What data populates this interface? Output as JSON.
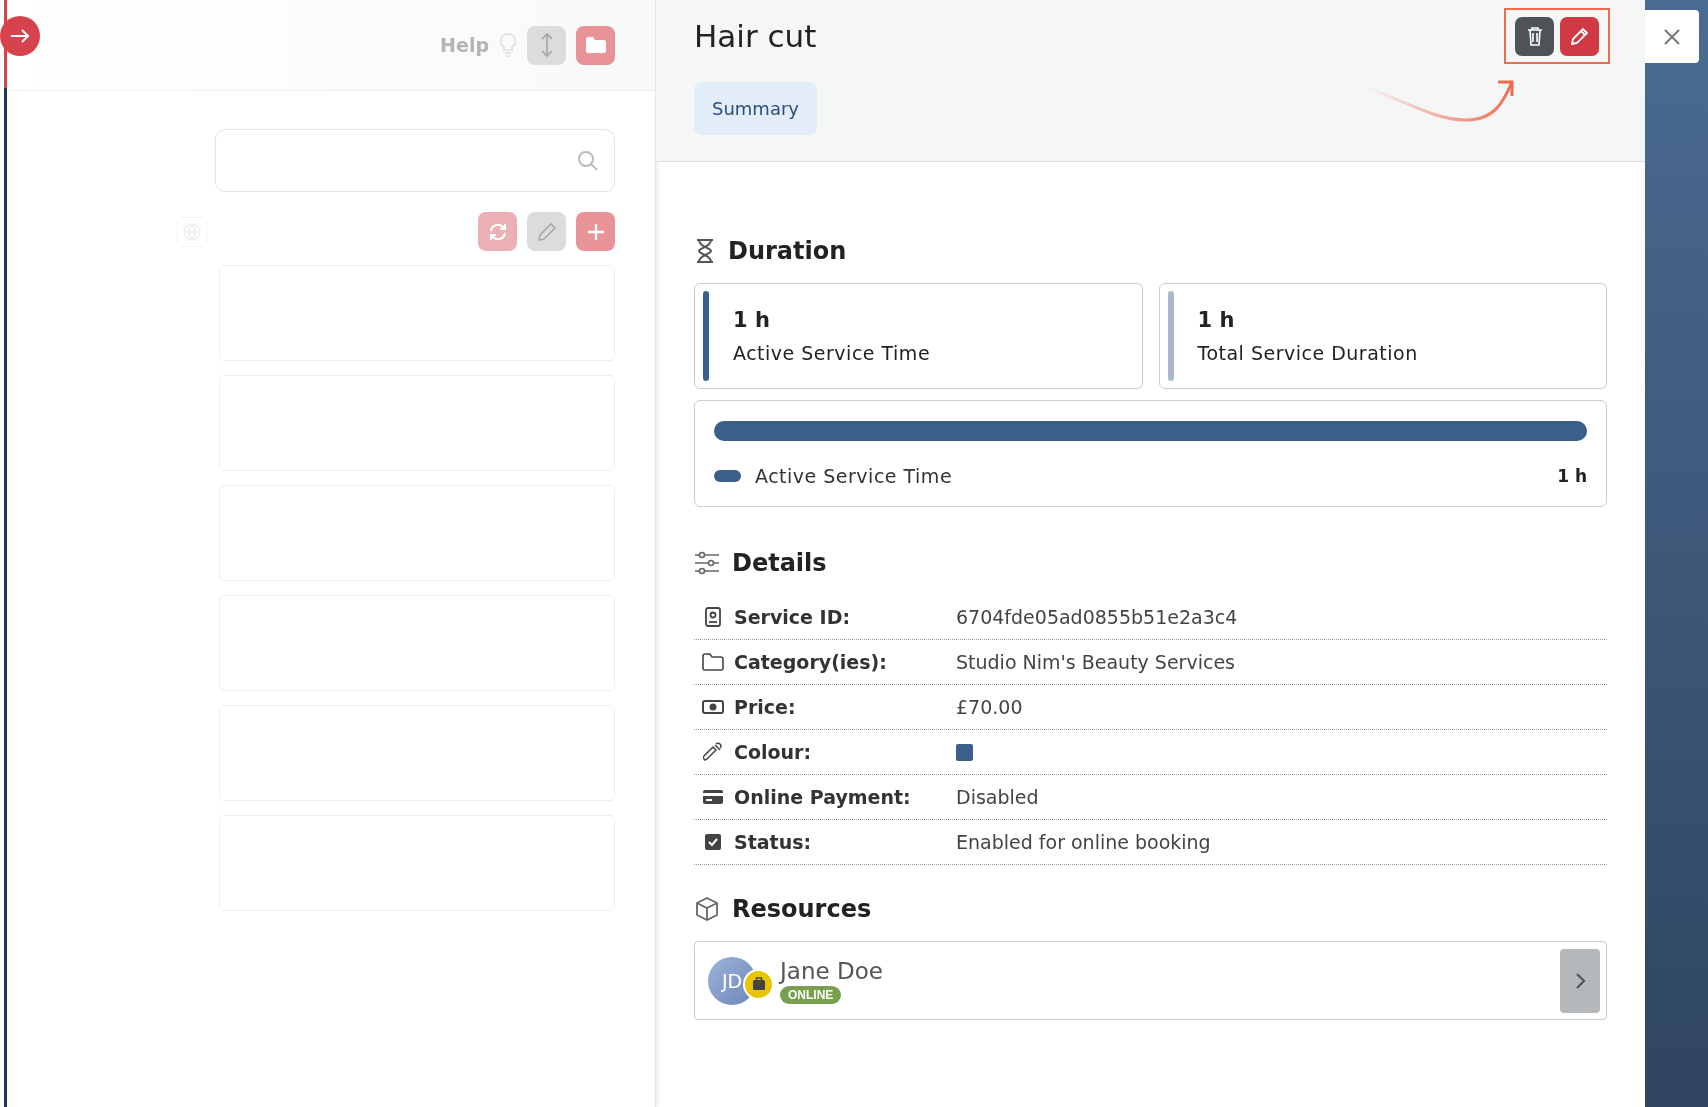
{
  "sidebar": {
    "help_label": "Help"
  },
  "panel": {
    "title": "Hair cut",
    "tabs": [
      {
        "label": "Summary",
        "selected": true
      }
    ],
    "duration": {
      "heading": "Duration",
      "cards": [
        {
          "value": "1 h",
          "label": "Active Service Time",
          "color": "#3a5f8a"
        },
        {
          "value": "1 h",
          "label": "Total Service Duration",
          "color": "#a9b8cb"
        }
      ],
      "bar": {
        "level": 1,
        "color": "#3a5f8a",
        "label": "Active Service Time",
        "reading": "1 h"
      }
    },
    "details": {
      "heading": "Details",
      "rows": [
        {
          "label": "Service ID:",
          "kind": "text",
          "value": "6704fde05ad0855b51e2a3c4"
        },
        {
          "label": "Category(ies):",
          "kind": "text",
          "value": "Studio Nim's Beauty Services"
        },
        {
          "label": "Price:",
          "kind": "text",
          "value": "£70.00"
        },
        {
          "label": "Colour:",
          "kind": "color",
          "color": "#3a5f8a"
        },
        {
          "label": "Online Payment:",
          "kind": "text",
          "value": "Disabled"
        },
        {
          "label": "Status:",
          "kind": "text",
          "value": "Enabled for online booking"
        }
      ]
    },
    "resources": {
      "heading": "Resources",
      "items": [
        {
          "initials": "JD",
          "name": "Jane Doe",
          "status": "ONLINE"
        }
      ]
    }
  }
}
